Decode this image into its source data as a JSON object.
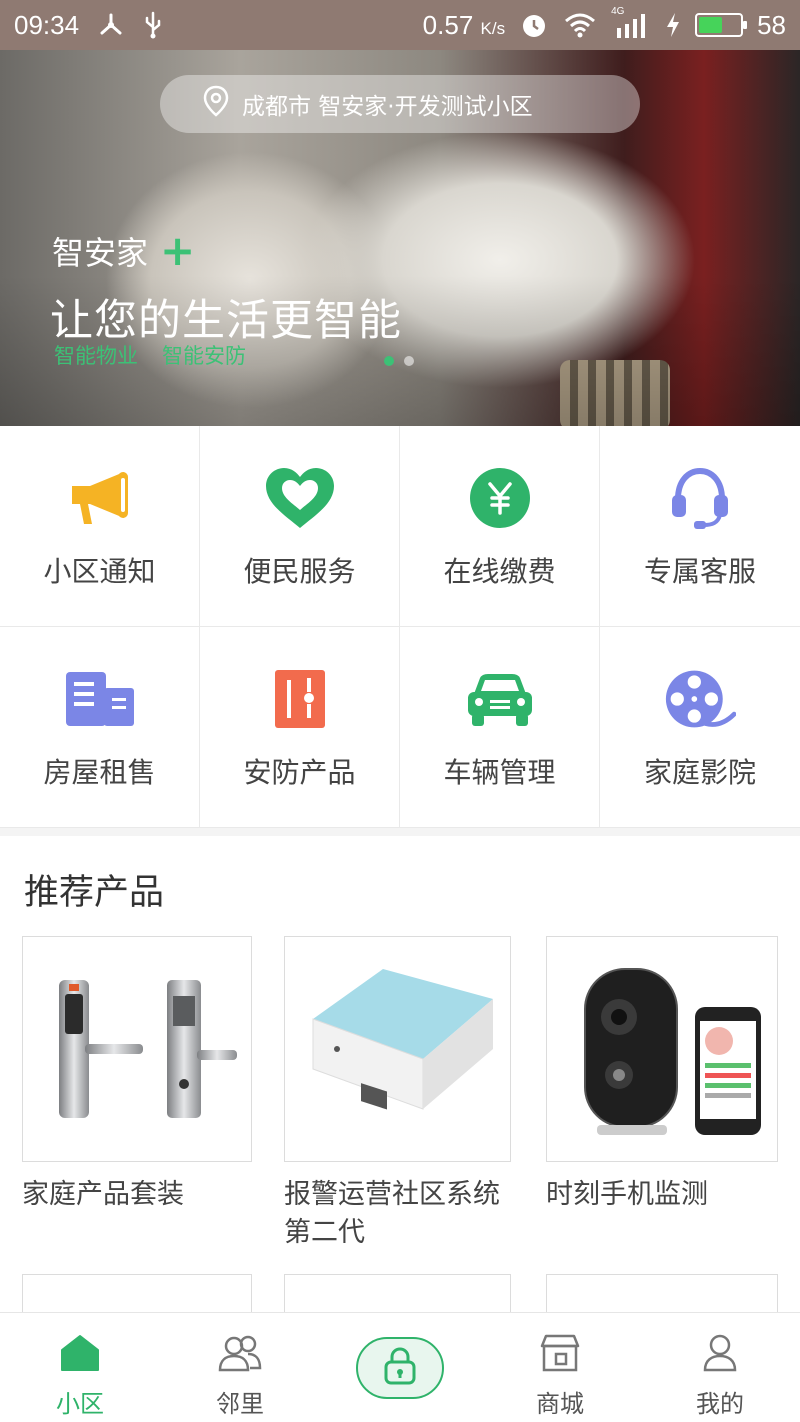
{
  "status_bar": {
    "time": "09:34",
    "net_speed": "0.57",
    "net_unit": "K/s",
    "network": "4G",
    "battery": "58"
  },
  "banner": {
    "location": "成都市 智安家·开发测试小区",
    "brand": "智安家",
    "headline": "让您的生活更智能",
    "tags": [
      "智能物业",
      "智能安防"
    ],
    "slide_count": 2,
    "active_slide": 1
  },
  "grid": [
    {
      "label": "小区通知",
      "icon": "megaphone-icon",
      "color": "#f5b324"
    },
    {
      "label": "便民服务",
      "icon": "heart-icon",
      "color": "#2fb36a"
    },
    {
      "label": "在线缴费",
      "icon": "yen-coin-icon",
      "color": "#2fb36a"
    },
    {
      "label": "专属客服",
      "icon": "headset-icon",
      "color": "#7b86e6"
    },
    {
      "label": "房屋租售",
      "icon": "building-doc-icon",
      "color": "#7b86e6"
    },
    {
      "label": "安防产品",
      "icon": "safe-box-icon",
      "color": "#f26b4d"
    },
    {
      "label": "车辆管理",
      "icon": "car-icon",
      "color": "#2fb36a"
    },
    {
      "label": "家庭影院",
      "icon": "film-reel-icon",
      "color": "#7b86e6"
    }
  ],
  "recommend": {
    "title": "推荐产品",
    "products": [
      {
        "name": "家庭产品套装"
      },
      {
        "name": "报警运营社区系统第二代"
      },
      {
        "name": "时刻手机监测"
      }
    ]
  },
  "tabbar": {
    "items": [
      {
        "label": "小区",
        "icon": "home-icon"
      },
      {
        "label": "邻里",
        "icon": "people-icon"
      },
      {
        "label": "",
        "icon": "lock-icon"
      },
      {
        "label": "商城",
        "icon": "store-icon"
      },
      {
        "label": "我的",
        "icon": "person-icon"
      }
    ],
    "active": "小区"
  },
  "colors": {
    "accent": "#2fb36a",
    "status_bar": "#8f7a72"
  }
}
